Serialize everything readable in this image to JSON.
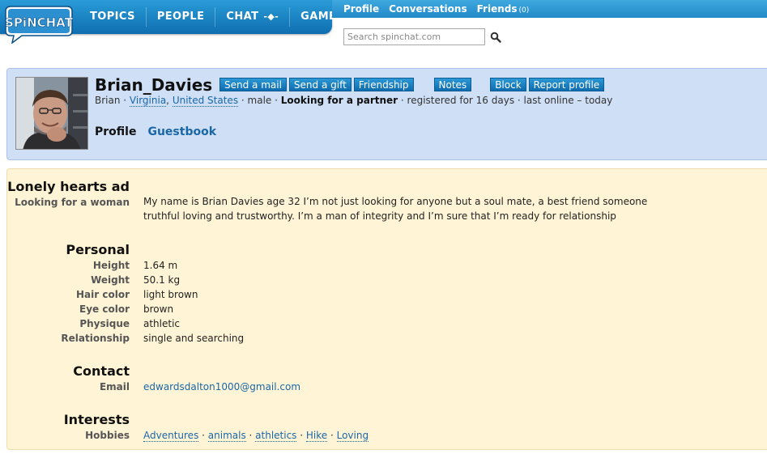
{
  "nav": {
    "logo_text": "SPiNCHAT",
    "items": [
      "TOPICS",
      "PEOPLE",
      "CHAT",
      "GAMES"
    ],
    "chat_arrow": "-◆-"
  },
  "subnav": {
    "profile": "Profile",
    "conversations": "Conversations",
    "friends": "Friends",
    "friends_count": "(0)"
  },
  "search": {
    "placeholder": "Search spinchat.com"
  },
  "profile": {
    "username": "Brian_Davies",
    "actions": [
      "Send a mail",
      "Send a gift",
      "Friendship",
      "Notes",
      "Block",
      "Report profile"
    ],
    "meta": {
      "name": "Brian",
      "state": "Virginia",
      "country": "United States",
      "gender": "male",
      "looking": "Looking for a partner",
      "registered": "registered for 16 days",
      "online": "last online – today"
    },
    "tabs": {
      "profile": "Profile",
      "guestbook": "Guestbook"
    }
  },
  "details": {
    "lonely_title": "Lonely hearts ad",
    "looking_label": "Looking for a woman",
    "ad_text": "My name is Brian Davies age 32 I’m not just looking for anyone but a soul mate, a best friend someone truthful loving and trustworthy. I’m a man of integrity and I’m sure that I’m ready for relationship",
    "personal_title": "Personal",
    "personal": [
      {
        "label": "Height",
        "value": "1.64 m"
      },
      {
        "label": "Weight",
        "value": "50.1 kg"
      },
      {
        "label": "Hair color",
        "value": "light brown"
      },
      {
        "label": "Eye color",
        "value": "brown"
      },
      {
        "label": "Physique",
        "value": "athletic"
      },
      {
        "label": "Relationship",
        "value": "single and searching"
      }
    ],
    "contact_title": "Contact",
    "email_label": "Email",
    "email": "edwardsdalton1000@gmail.com",
    "interests_title": "Interests",
    "hobbies_label": "Hobbies",
    "hobbies": [
      "Adventures",
      "animals",
      "athletics",
      "Hike",
      "Loving"
    ]
  },
  "colors": {
    "nav_blue": "#0f6fb0",
    "header_bg": "#cfdff5",
    "details_bg": "#fff4d5",
    "link": "#1a67a8"
  }
}
